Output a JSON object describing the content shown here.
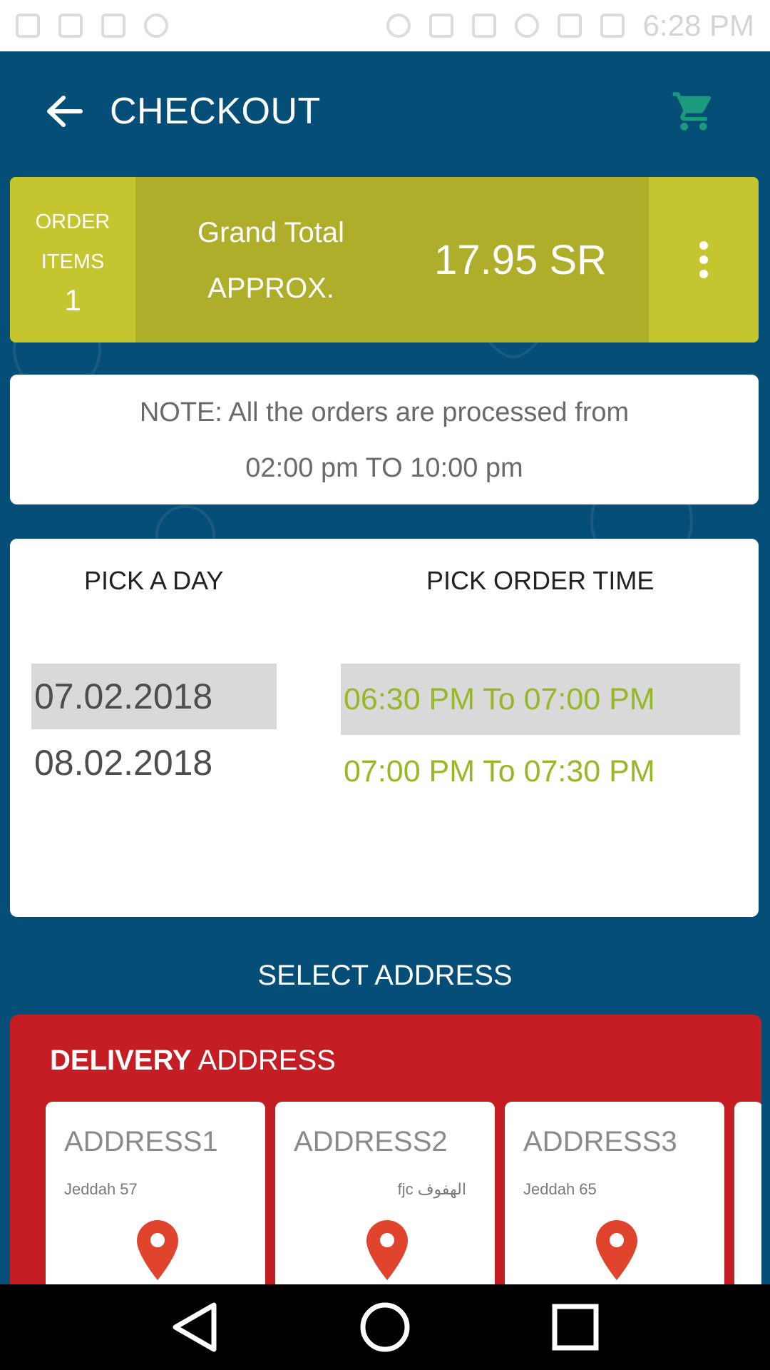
{
  "status_bar": {
    "clock": "6:28 PM"
  },
  "app_bar": {
    "title": "CHECKOUT",
    "back_icon": "arrow-left-icon",
    "cart_icon": "cart-icon"
  },
  "summary": {
    "order_items_label_1": "ORDER",
    "order_items_label_2": "ITEMS",
    "order_items_count": "1",
    "grand_total_label": "Grand Total",
    "approx_label": "APPROX.",
    "total_value": "17.95 SR"
  },
  "note": {
    "line1": "NOTE: All the orders are processed from",
    "line2": "02:00 pm TO 10:00 pm"
  },
  "picker": {
    "day_heading": "PICK A DAY",
    "time_heading": "PICK ORDER TIME",
    "days": [
      "07.02.2018",
      "08.02.2018"
    ],
    "times": [
      "06:30 PM To 07:00 PM",
      "07:00 PM To 07:30 PM"
    ]
  },
  "select_address_label": "SELECT ADDRESS",
  "delivery": {
    "title_bold": "DELIVERY",
    "title_rest": " ADDRESS",
    "addresses": [
      {
        "name": "ADDRESS1",
        "detail": "Jeddah 57"
      },
      {
        "name": "ADDRESS2",
        "detail": "fjc الهفوف"
      },
      {
        "name": "ADDRESS3",
        "detail": "Jeddah 65"
      }
    ]
  },
  "colors": {
    "app_bg": "#054e78",
    "summary_light": "#c5c52f",
    "summary_dark": "#aeae2b",
    "time_text": "#97b825",
    "delivery_bg": "#c41d23",
    "pin": "#e0442c"
  }
}
